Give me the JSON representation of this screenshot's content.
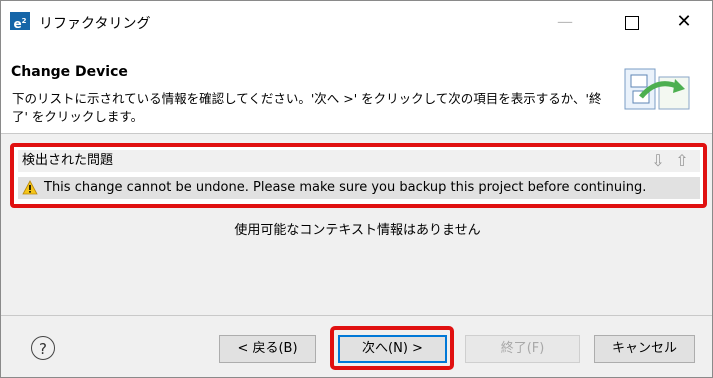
{
  "window": {
    "app_icon": "e²",
    "title": "リファクタリング",
    "controls": {
      "minimize": "—",
      "close": "✕"
    }
  },
  "header": {
    "title": "Change Device",
    "description": "下のリストに示されている情報を確認してください。'次へ >' をクリックして次の項目を表示するか、'終了' をクリックします。"
  },
  "problems": {
    "heading": "検出された問題",
    "nav_down": "⇩",
    "nav_up": "⇧",
    "items": [
      {
        "icon": "warning-icon",
        "message": "This change cannot be undone. Please make sure you backup this project before continuing."
      }
    ]
  },
  "context_info": "使用可能なコンテキスト情報はありません",
  "buttons": {
    "help": "?",
    "back": "< 戻る(B)",
    "next": "次へ(N) >",
    "finish": "終了(F)",
    "cancel": "キャンセル"
  },
  "colors": {
    "highlight": "#e01010",
    "focus": "#0078d7"
  }
}
